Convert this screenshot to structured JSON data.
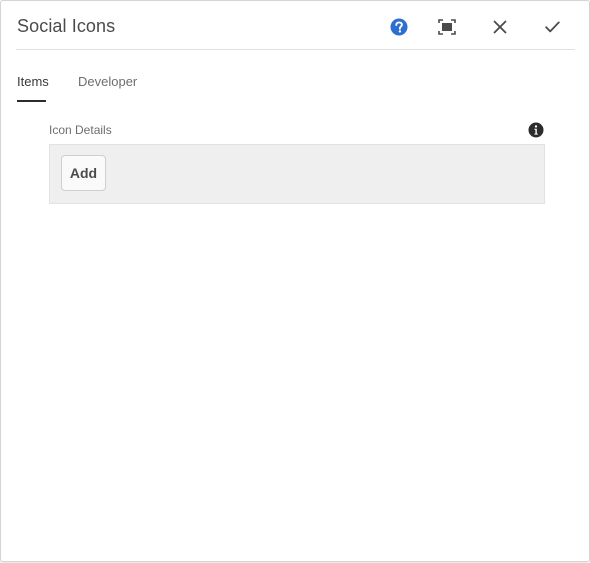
{
  "dialog": {
    "title": "Social Icons",
    "actions": {
      "help_icon": "help-icon",
      "fullscreen_icon": "fullscreen-icon",
      "close_icon": "close-icon",
      "done_icon": "checkmark-icon"
    }
  },
  "tabs": [
    {
      "label": "Items",
      "active": true
    },
    {
      "label": "Developer",
      "active": false
    }
  ],
  "field": {
    "label": "Icon Details",
    "info_icon": "info-icon",
    "add_button_label": "Add"
  },
  "colors": {
    "help_icon": "#2d6ecf",
    "tab_indicator": "#2c2c2c",
    "multifield_bg": "#efefef"
  }
}
